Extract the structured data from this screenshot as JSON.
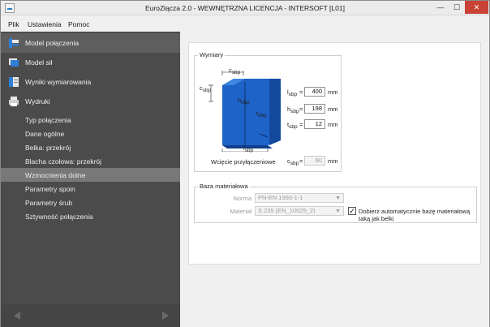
{
  "window": {
    "title": "EuroZłącza 2.0 - WEWNĘTRZNA LICENCJA - INTERSOFT [L01]",
    "controls": {
      "minimize": "—",
      "maximize": "☐",
      "close": "✕"
    }
  },
  "menu": [
    {
      "label": "Plik"
    },
    {
      "label": "Ustawienia"
    },
    {
      "label": "Pomoc"
    }
  ],
  "sidebar": {
    "main_items": [
      {
        "label": "Model połączenia",
        "icon": "connection-model-icon",
        "active": true
      },
      {
        "label": "Model sił",
        "icon": "forces-model-icon",
        "active": false
      },
      {
        "label": "Wyniki wymiarowania",
        "icon": "results-icon",
        "active": false
      },
      {
        "label": "Wydruki",
        "icon": "printer-icon",
        "active": false
      }
    ],
    "sub_items": [
      {
        "label": "Typ połączenia",
        "active": false
      },
      {
        "label": "Dane ogólne",
        "active": false
      },
      {
        "label": "Belka: przekrój",
        "active": false
      },
      {
        "label": "Blacha czołowa: przekrój",
        "active": false
      },
      {
        "label": "Wzmocnienia dolne",
        "active": true
      },
      {
        "label": "Parametry spoin",
        "active": false
      },
      {
        "label": "Parametry śrub",
        "active": false
      },
      {
        "label": "Sztywność połączenia",
        "active": false
      }
    ],
    "footer": {
      "prev_icon": "arrow-left-icon",
      "next_icon": "arrow-right-icon"
    }
  },
  "dimensions": {
    "title": "Wymiary",
    "diagram_labels": {
      "c_top": "c",
      "c_side": "c",
      "h": "h",
      "t": "t",
      "l": "l",
      "sub": "sbp"
    },
    "fields": [
      {
        "sym": "l",
        "sub": "sbp",
        "eq": "=",
        "value": "400",
        "unit": "mm"
      },
      {
        "sym": "h",
        "sub": "sbp",
        "eq": "=",
        "value": "198",
        "unit": "mm"
      },
      {
        "sym": "t",
        "sub": "sbp",
        "eq": "=",
        "value": "12",
        "unit": "mm"
      }
    ],
    "cut_label": "Wcięcie przyłączeniowe",
    "cut": {
      "sym": "c",
      "sub": "sbp",
      "eq": "=",
      "value": "60",
      "unit": "mm"
    }
  },
  "material": {
    "title": "Baza materiałowa",
    "norm_label": "Norma",
    "norm_value": "PN-EN 1993-1-1",
    "material_label": "Materiał",
    "material_value": "S 235 (EN_10025_2)",
    "auto_label": "Dobierz automatycznie bazę materiałową taką jak belki",
    "auto_checked": "✓"
  },
  "colors": {
    "sidebar": "#4b4b4b",
    "plate": "#1a5fc4",
    "plate_dark": "#0f3f8c"
  }
}
